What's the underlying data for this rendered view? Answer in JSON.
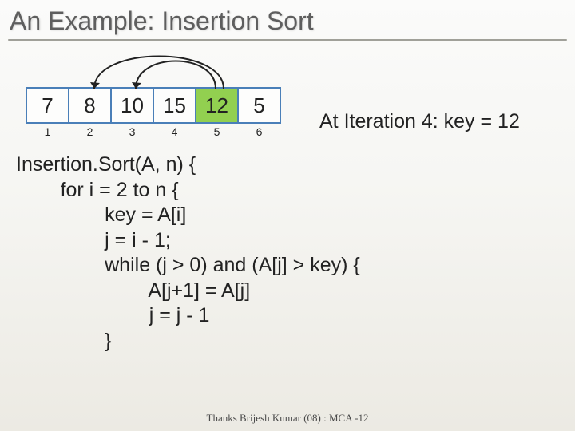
{
  "title": "An Example: Insertion Sort",
  "array": {
    "cells": [
      {
        "value": "7",
        "highlight": false
      },
      {
        "value": "8",
        "highlight": false
      },
      {
        "value": "10",
        "highlight": false
      },
      {
        "value": "15",
        "highlight": false
      },
      {
        "value": "12",
        "highlight": true
      },
      {
        "value": "5",
        "highlight": false
      }
    ],
    "indices": [
      "1",
      "2",
      "3",
      "4",
      "5",
      "6"
    ]
  },
  "caption": "At Iteration 4: key = 12",
  "code": {
    "l1": "Insertion.Sort(A, n) {",
    "l2": "        for i = 2 to n {",
    "l3": "                key = A[i]",
    "l4": "                j = i - 1;",
    "l5": "                while (j > 0) and (A[j] > key) {",
    "l6": "                        A[j+1] = A[j]",
    "l7": "                        j = j - 1",
    "l8": "                }"
  },
  "credit": "Thanks Brijesh Kumar (08) : MCA -12"
}
